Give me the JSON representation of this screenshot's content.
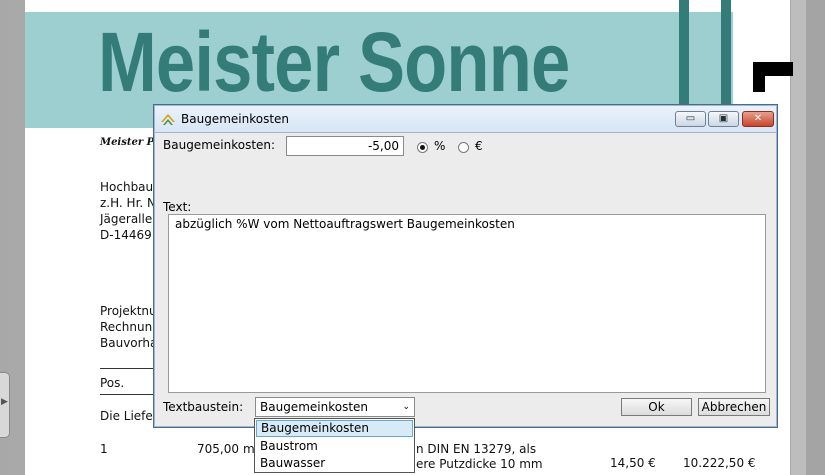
{
  "document": {
    "company_name": "Meister Sonne",
    "sender_line": "Meister Pe",
    "address": [
      "Hochbau",
      "z.H. Hr. N",
      "Jägeralle",
      "D-14469"
    ],
    "project": [
      "Projektnu",
      "Rechnun",
      "Bauvorha"
    ],
    "pos_header": "Pos.",
    "intro": "Die Liefer",
    "row": {
      "pos": "1",
      "qty": "705,00",
      "unit": "m",
      "desc1": "n DIN EN 13279, als",
      "desc2": "ere Putzdicke 10 mm",
      "price": "14,50 €",
      "total": "10.222,50 €"
    }
  },
  "dialog": {
    "title": "Baugemeinkosten",
    "controls": {
      "minimize": "▭",
      "maximize": "▣",
      "close": "✕"
    },
    "amount_label": "Baugemeinkosten:",
    "amount_value": "-5,00",
    "radio_percent": "%",
    "radio_euro": "€",
    "selected_unit": "%",
    "text_label": "Text:",
    "text_value": "abzüglich %W vom Nettoauftragswert Baugemeinkosten",
    "textbaustein_label": "Textbaustein:",
    "textbaustein_value": "Baugemeinkosten",
    "ok_label": "Ok",
    "cancel_label": "Abbrechen"
  },
  "dropdown": {
    "options": [
      "Baugemeinkosten",
      "Baustrom",
      "Bauwasser"
    ],
    "selected_index": 0
  },
  "colors": {
    "banner": "#9ecfd0",
    "brand_text": "#347c77",
    "dialog_bg": "#ececec"
  }
}
